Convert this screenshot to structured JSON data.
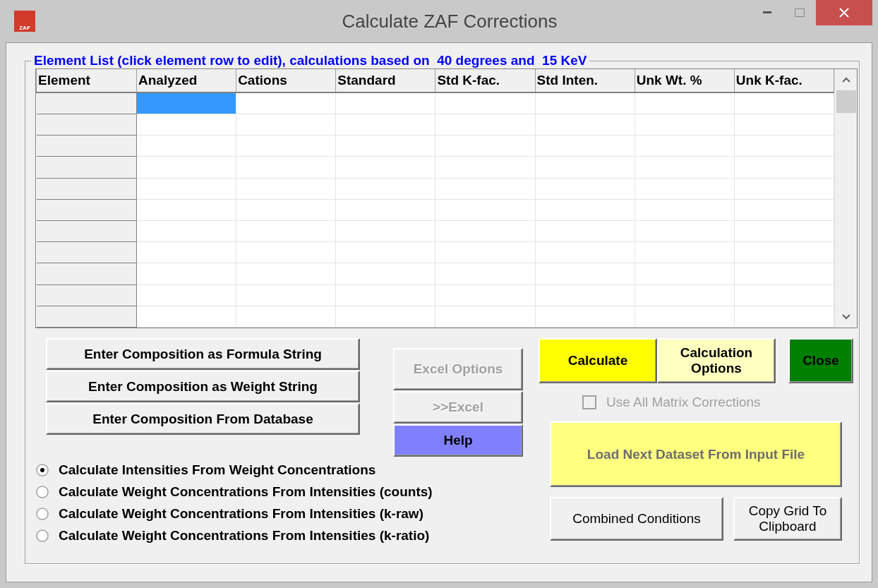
{
  "window": {
    "title": "Calculate ZAF Corrections",
    "icon_label": "ZAF"
  },
  "group": {
    "legend": "Element List (click element row to edit), calculations based on  40 degrees and  15 KeV"
  },
  "table": {
    "columns": [
      "Element",
      "Analyzed",
      "Cations",
      "Standard",
      "Std K-fac.",
      "Std Inten.",
      "Unk Wt. %",
      "Unk K-fac."
    ],
    "rows": [
      {
        "cells": [
          {
            "selected": true
          },
          {
            "selected": false
          },
          {
            "selected": false
          },
          {
            "selected": false
          },
          {
            "selected": false
          },
          {
            "selected": false
          },
          {
            "selected": false
          }
        ]
      },
      {
        "cells": [
          {
            "selected": false
          },
          {
            "selected": false
          },
          {
            "selected": false
          },
          {
            "selected": false
          },
          {
            "selected": false
          },
          {
            "selected": false
          },
          {
            "selected": false
          }
        ]
      },
      {
        "cells": [
          {
            "selected": false
          },
          {
            "selected": false
          },
          {
            "selected": false
          },
          {
            "selected": false
          },
          {
            "selected": false
          },
          {
            "selected": false
          },
          {
            "selected": false
          }
        ]
      },
      {
        "cells": [
          {
            "selected": false
          },
          {
            "selected": false
          },
          {
            "selected": false
          },
          {
            "selected": false
          },
          {
            "selected": false
          },
          {
            "selected": false
          },
          {
            "selected": false
          }
        ]
      },
      {
        "cells": [
          {
            "selected": false
          },
          {
            "selected": false
          },
          {
            "selected": false
          },
          {
            "selected": false
          },
          {
            "selected": false
          },
          {
            "selected": false
          },
          {
            "selected": false
          }
        ]
      },
      {
        "cells": [
          {
            "selected": false
          },
          {
            "selected": false
          },
          {
            "selected": false
          },
          {
            "selected": false
          },
          {
            "selected": false
          },
          {
            "selected": false
          },
          {
            "selected": false
          }
        ]
      },
      {
        "cells": [
          {
            "selected": false
          },
          {
            "selected": false
          },
          {
            "selected": false
          },
          {
            "selected": false
          },
          {
            "selected": false
          },
          {
            "selected": false
          },
          {
            "selected": false
          }
        ]
      },
      {
        "cells": [
          {
            "selected": false
          },
          {
            "selected": false
          },
          {
            "selected": false
          },
          {
            "selected": false
          },
          {
            "selected": false
          },
          {
            "selected": false
          },
          {
            "selected": false
          }
        ]
      },
      {
        "cells": [
          {
            "selected": false
          },
          {
            "selected": false
          },
          {
            "selected": false
          },
          {
            "selected": false
          },
          {
            "selected": false
          },
          {
            "selected": false
          },
          {
            "selected": false
          }
        ]
      },
      {
        "cells": [
          {
            "selected": false
          },
          {
            "selected": false
          },
          {
            "selected": false
          },
          {
            "selected": false
          },
          {
            "selected": false
          },
          {
            "selected": false
          },
          {
            "selected": false
          }
        ]
      },
      {
        "cells": [
          {
            "selected": false
          },
          {
            "selected": false
          },
          {
            "selected": false
          },
          {
            "selected": false
          },
          {
            "selected": false
          },
          {
            "selected": false
          },
          {
            "selected": false
          }
        ]
      }
    ]
  },
  "composition_buttons": [
    "Enter Composition as Formula String",
    "Enter Composition as Weight String",
    "Enter Composition From Database"
  ],
  "excel_buttons": [
    {
      "label": "Excel Options",
      "disabled": true,
      "color": "#f0f0f0"
    },
    {
      "label": ">>Excel",
      "disabled": true,
      "color": "#f0f0f0"
    },
    {
      "label": "Help",
      "disabled": false,
      "color": "#8080ff"
    }
  ],
  "calculation_modes": [
    {
      "label": "Calculate Intensities From Weight Concentrations",
      "selected": true
    },
    {
      "label": "Calculate Weight Concentrations From Intensities (counts)",
      "selected": false
    },
    {
      "label": "Calculate Weight Concentrations From Intensities (k-raw)",
      "selected": false
    },
    {
      "label": "Calculate Weight Concentrations From Intensities (k-ratio)",
      "selected": false
    }
  ],
  "top_buttons": [
    {
      "label": "Calculate",
      "color": "#ffff00"
    },
    {
      "label": "Calculation Options",
      "color": "#ffffc0"
    },
    {
      "label": "Close",
      "color": "#008000"
    }
  ],
  "matrix_checkbox": {
    "label": "Use All Matrix Corrections",
    "checked": false,
    "disabled": true
  },
  "load_button": {
    "label": "Load Next Dataset From Input File",
    "disabled": true,
    "color": "#ffff80"
  },
  "bottom_buttons": [
    "Combined Conditions",
    "Copy Grid To Clipboard"
  ]
}
